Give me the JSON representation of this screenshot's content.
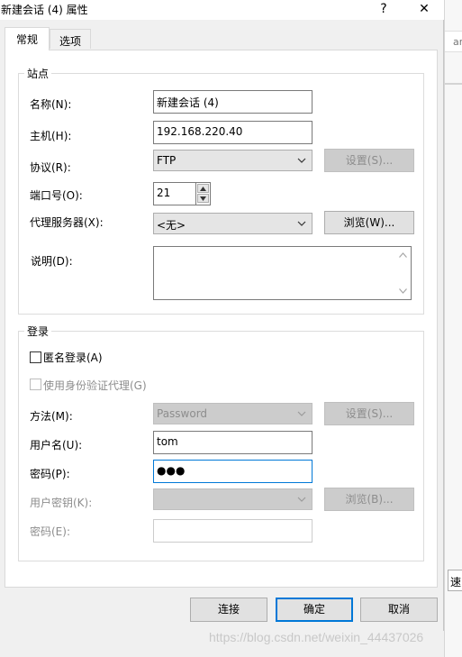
{
  "window": {
    "title": "新建会话 (4) 属性",
    "help_glyph": "?",
    "close_glyph": "✕"
  },
  "tabs": [
    {
      "label": "常规",
      "active": true
    },
    {
      "label": "选项",
      "active": false
    }
  ],
  "site": {
    "group_label": "站点",
    "name_label": "名称(N):",
    "name_value": "新建会话 (4)",
    "host_label": "主机(H):",
    "host_value": "192.168.220.40",
    "protocol_label": "协议(R):",
    "protocol_value": "FTP",
    "protocol_settings_button": "设置(S)...",
    "port_label": "端口号(O):",
    "port_value": "21",
    "proxy_label": "代理服务器(X):",
    "proxy_value": "<无>",
    "proxy_browse_button": "浏览(W)...",
    "description_label": "说明(D):",
    "description_value": ""
  },
  "login": {
    "group_label": "登录",
    "anonymous_label": "匿名登录(A)",
    "anonymous_checked": false,
    "auth_proxy_label": "使用身份验证代理(G)",
    "auth_proxy_checked": false,
    "method_label": "方法(M):",
    "method_value": "Password",
    "method_settings_button": "设置(S)...",
    "username_label": "用户名(U):",
    "username_value": "tom",
    "password_label": "密码(P):",
    "password_value": "●●●",
    "user_key_label": "用户密钥(K):",
    "user_key_value": "",
    "user_key_browse_button": "浏览(B)...",
    "passphrase_label": "密码(E):",
    "passphrase_value": ""
  },
  "footer": {
    "connect_button": "连接",
    "ok_button": "确定",
    "cancel_button": "取消"
  },
  "background_app": {
    "tab_fragment": "ar",
    "button_fragment": "速"
  },
  "watermark": "https://blog.csdn.net/weixin_44437026",
  "colors": {
    "focus_border": "#0078d7",
    "disabled_text": "#8d8d8d"
  }
}
